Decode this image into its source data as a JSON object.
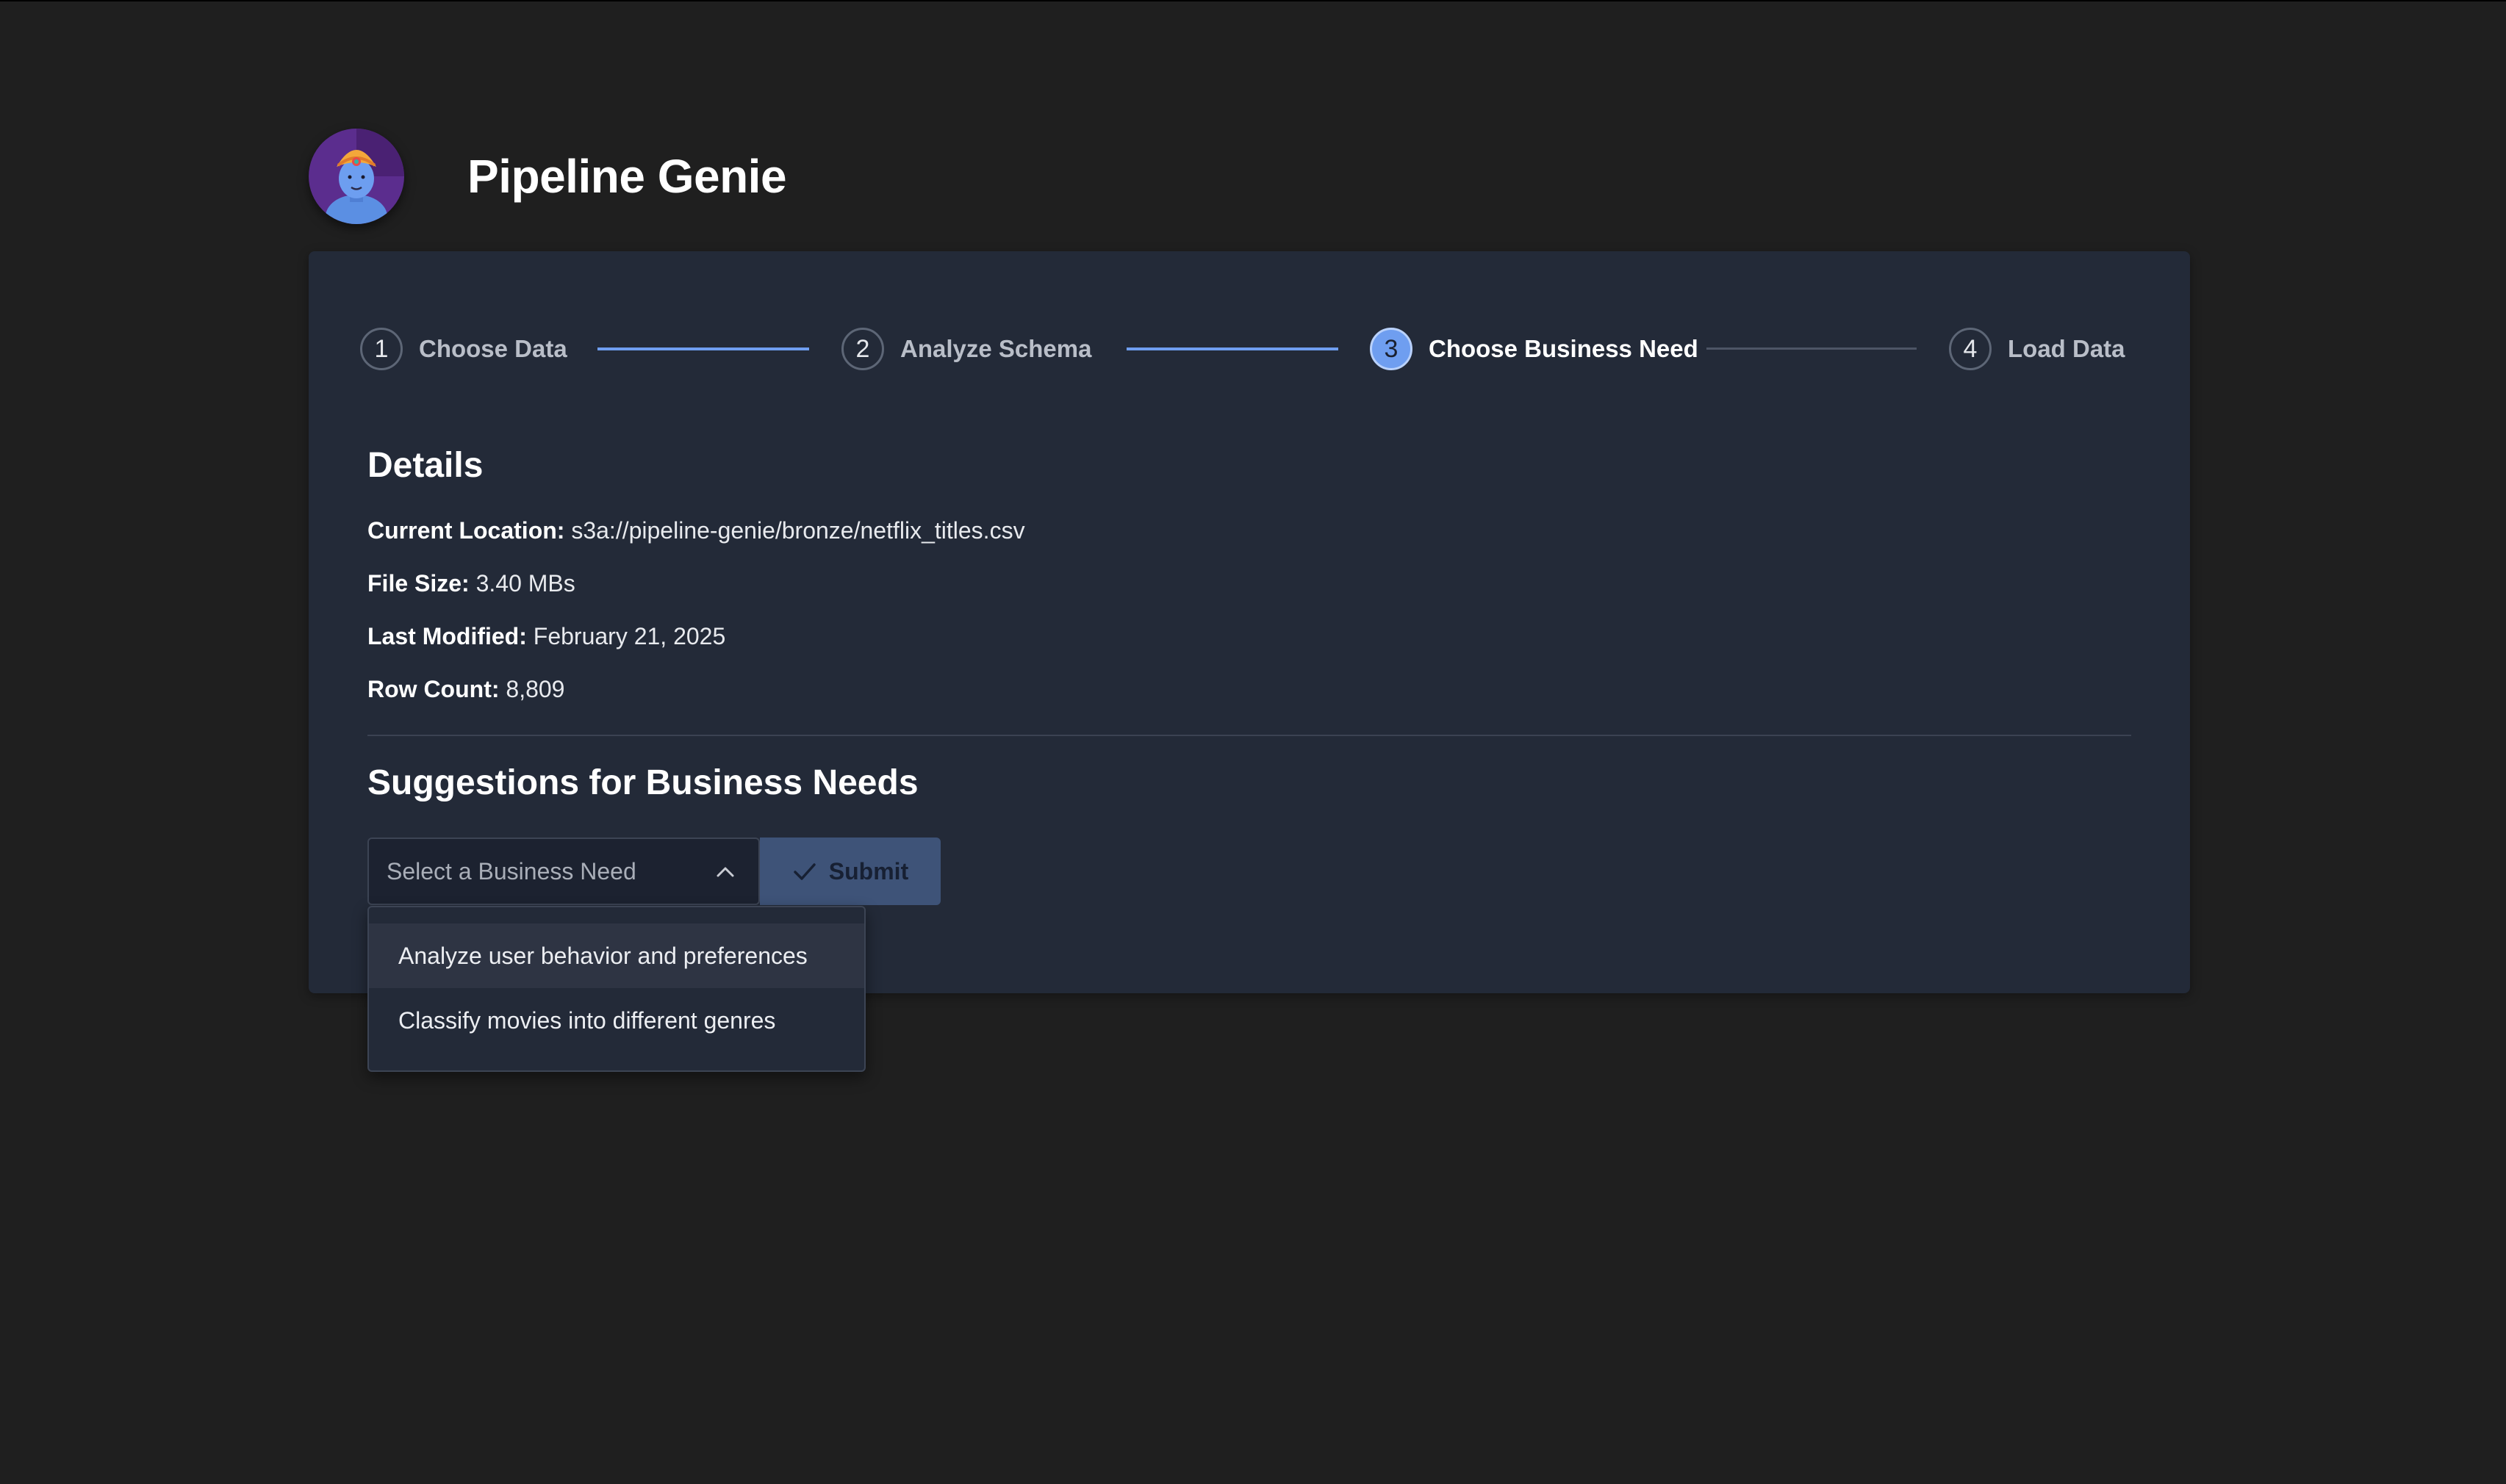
{
  "app": {
    "title": "Pipeline Genie"
  },
  "stepper": {
    "steps": [
      {
        "number": "1",
        "label": "Choose Data",
        "state": "completed"
      },
      {
        "number": "2",
        "label": "Analyze Schema",
        "state": "completed"
      },
      {
        "number": "3",
        "label": "Choose Business Need",
        "state": "active"
      },
      {
        "number": "4",
        "label": "Load Data",
        "state": "pending"
      }
    ]
  },
  "details": {
    "title": "Details",
    "rows": [
      {
        "key": "Current Location:",
        "value": " s3a://pipeline-genie/bronze/netflix_titles.csv"
      },
      {
        "key": "File Size:",
        "value": " 3.40 MBs"
      },
      {
        "key": "Last Modified:",
        "value": " February 21, 2025"
      },
      {
        "key": "Row Count:",
        "value": " 8,809"
      }
    ]
  },
  "suggestions": {
    "title": "Suggestions for Business Needs",
    "select_placeholder": "Select a Business Need",
    "submit_label": "Submit",
    "options": [
      "Analyze user behavior and preferences",
      "Classify movies into different genres"
    ]
  },
  "colors": {
    "accent": "#6f9ef0",
    "card_bg": "#232a38",
    "page_bg": "#1f1f1f",
    "submit_bg": "#3e5378"
  },
  "icons": {
    "avatar": "genie-avatar",
    "chevron": "chevron-up-icon",
    "submit": "check-icon"
  }
}
